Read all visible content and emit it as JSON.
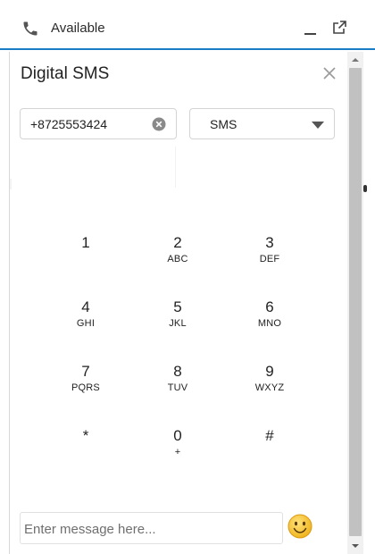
{
  "status_bar": {
    "status": "Available"
  },
  "panel": {
    "title": "Digital SMS"
  },
  "recipient": {
    "phone_number": "+8725553424",
    "channel": "SMS"
  },
  "dialpad": {
    "keys": [
      {
        "digit": "1",
        "letters": ""
      },
      {
        "digit": "2",
        "letters": "ABC"
      },
      {
        "digit": "3",
        "letters": "DEF"
      },
      {
        "digit": "4",
        "letters": "GHI"
      },
      {
        "digit": "5",
        "letters": "JKL"
      },
      {
        "digit": "6",
        "letters": "MNO"
      },
      {
        "digit": "7",
        "letters": "PQRS"
      },
      {
        "digit": "8",
        "letters": "TUV"
      },
      {
        "digit": "9",
        "letters": "WXYZ"
      },
      {
        "digit": "*",
        "letters": ""
      },
      {
        "digit": "0",
        "letters": "+"
      },
      {
        "digit": "#",
        "letters": ""
      }
    ]
  },
  "composer": {
    "placeholder": "Enter message here...",
    "value": ""
  },
  "icons": {
    "status": "phone-icon",
    "minimize": "minimize-icon",
    "popout": "popout-icon",
    "close": "close-icon",
    "clear": "clear-circle-icon",
    "dropdown": "chevron-down-icon",
    "emoji": "smiley-emoji-icon"
  },
  "colors": {
    "accent": "#1b7cc6",
    "emoji_yellow": "#f5c12e"
  }
}
